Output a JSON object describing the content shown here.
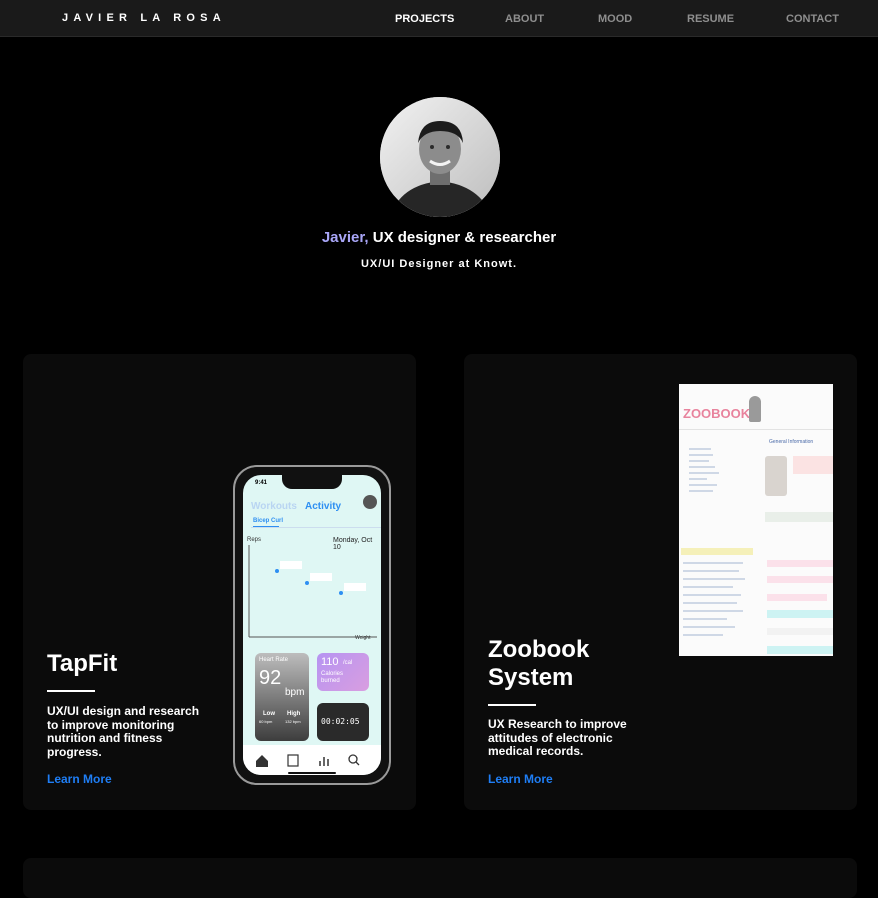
{
  "nav": {
    "brand": "JAVIER LA ROSA",
    "links": [
      {
        "label": "PROJECTS",
        "active": true
      },
      {
        "label": "ABOUT",
        "active": false
      },
      {
        "label": "MOOD",
        "active": false
      },
      {
        "label": "RESUME",
        "active": false
      },
      {
        "label": "CONTACT",
        "active": false
      }
    ]
  },
  "hero": {
    "name": "Javier,",
    "headline": "UX designer & researcher",
    "subtitle": "UX/UI Designer at Knowt."
  },
  "projects": [
    {
      "title": "TapFit",
      "description": "UX/UI design and research to improve monitoring nutrition and fitness progress.",
      "cta": "Learn More"
    },
    {
      "title": "Zoobook\nSystem",
      "description": "UX Research to improve attitudes of electronic medical records.",
      "cta": "Learn More"
    }
  ],
  "tapfit_phone": {
    "time": "9:41",
    "tab_inactive": "Workouts",
    "tab_active": "Activity",
    "subtab": "Bicep Curl",
    "date": "Monday, Oct 10",
    "y_label": "Reps",
    "x_label": "Weight",
    "heart_rate_label": "Heart Rate",
    "heart_rate_value": "92",
    "heart_rate_unit": "bpm",
    "low_label": "Low",
    "low_value": "60 bpm",
    "high_label": "High",
    "high_value": "132 bpm",
    "calories_value": "110",
    "calories_unit": "/cal",
    "calories_label": "Calories",
    "calories_sub": "burned",
    "timer": "00:02:05"
  },
  "zoobook_shot": {
    "logo": "ZOOBOOK",
    "section_title": "General Information"
  },
  "colors": {
    "accent_name": "#a9a6f7",
    "link": "#1f7ef5",
    "card_bg": "#0b0b0b",
    "nav_bg": "#1a1a1a"
  }
}
